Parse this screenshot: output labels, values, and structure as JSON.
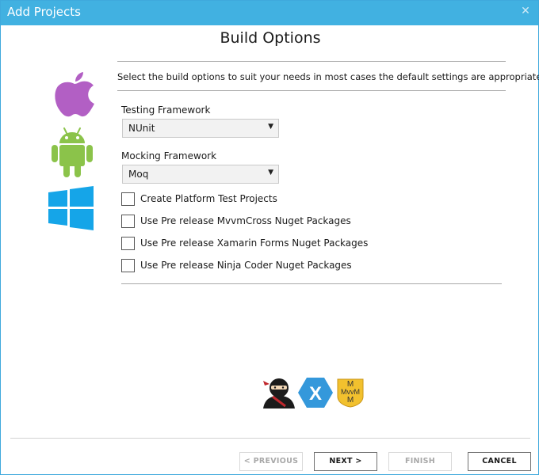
{
  "window": {
    "title": "Add Projects",
    "close_glyph": "✕"
  },
  "page": {
    "heading": "Build Options",
    "description": "Select the build options to suit your needs in most cases the default settings are appropriate."
  },
  "platform_icons": [
    "apple-icon",
    "android-icon",
    "windows-icon"
  ],
  "testing": {
    "label": "Testing Framework",
    "value": "NUnit"
  },
  "mocking": {
    "label": "Mocking Framework",
    "value": "Moq"
  },
  "dropdown_arrow": "▼",
  "options": [
    {
      "label": "Create Platform Test Projects",
      "checked": false
    },
    {
      "label": "Use Pre release MvvmCross Nuget Packages",
      "checked": false
    },
    {
      "label": "Use Pre release Xamarin Forms Nuget Packages",
      "checked": false
    },
    {
      "label": "Use Pre release Ninja Coder Nuget Packages",
      "checked": false
    }
  ],
  "footer_logos": [
    "ninja-coder-logo",
    "xamarin-logo",
    "mvvmcross-logo"
  ],
  "mvvm_logo_text": {
    "top": "M",
    "mid": "MvvM",
    "bottom": "M"
  },
  "xamarin_letter": "X",
  "buttons": {
    "previous": "< PREVIOUS",
    "next": "NEXT >",
    "finish": "FINISH",
    "cancel": "CANCEL"
  },
  "colors": {
    "titlebar": "#41b1e1",
    "apple": "#b25fc4",
    "android": "#8bc34a",
    "windows": "#15a5e8",
    "xamarin": "#3498db",
    "mvvm": "#f2c12e"
  }
}
